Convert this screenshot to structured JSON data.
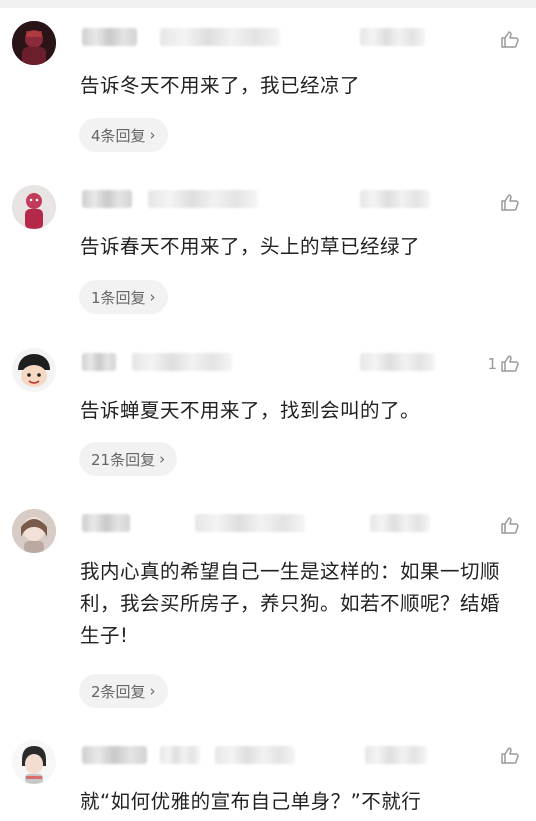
{
  "comments": [
    {
      "text": "告诉冬天不用来了，我已经凉了",
      "likes": "",
      "reply": "4条回复"
    },
    {
      "text": "告诉春天不用来了，头上的草已经绿了",
      "likes": "",
      "reply": "1条回复"
    },
    {
      "text": "告诉蝉夏天不用来了，找到会叫的了。",
      "likes": "1",
      "reply": "21条回复"
    },
    {
      "text": "我内心真的希望自己一生是这样的：如果一切顺利，我会买所房子，养只狗。如若不顺呢？结婚 生子!",
      "likes": "",
      "reply": "2条回复"
    },
    {
      "text": "就“如何优雅的宣布自己单身？”不就行",
      "likes": ""
    }
  ],
  "colors": {
    "icon": "#9a9a9a",
    "reply_bg": "#f2f2f2",
    "text": "#222222"
  },
  "icons": {
    "like": "thumbs-up-icon",
    "reply_more": "chevron-right-icon"
  }
}
